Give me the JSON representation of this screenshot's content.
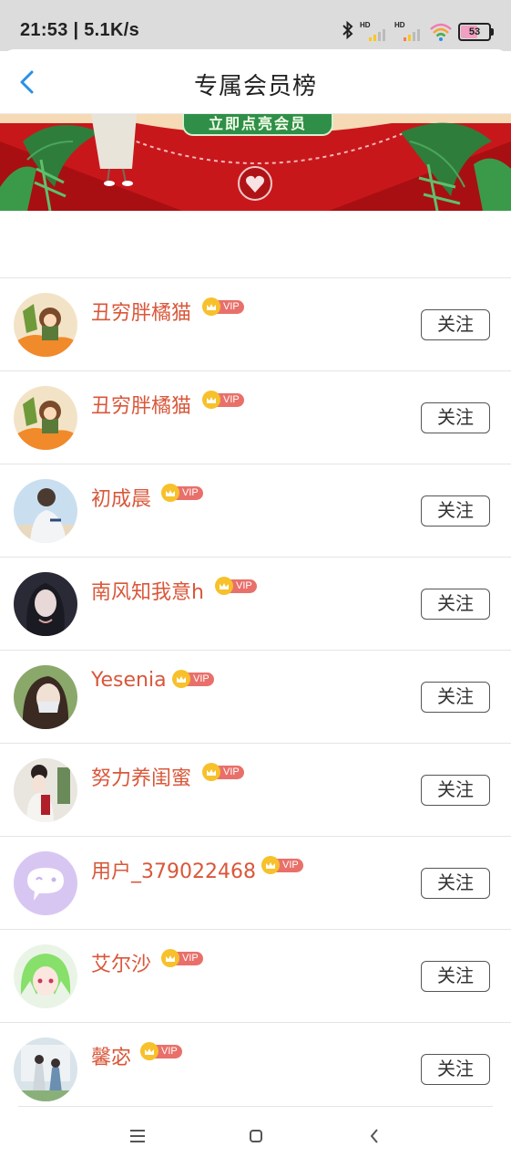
{
  "status_bar": {
    "time": "21:53 | 5.1K/s",
    "battery": "53",
    "hd_label_1": "HD",
    "hd_label_2": "HD"
  },
  "header": {
    "title": "专属会员榜",
    "back_icon": "chevron-left-icon"
  },
  "banner": {
    "cta_label": "立即点亮会员"
  },
  "members": [
    {
      "name": "丑穷胖橘猫",
      "badge": "VIP",
      "follow_label": "关注"
    },
    {
      "name": "丑穷胖橘猫",
      "badge": "VIP",
      "follow_label": "关注"
    },
    {
      "name": "初成晨",
      "badge": "VIP",
      "follow_label": "关注"
    },
    {
      "name": "南风知我意h",
      "badge": "VIP",
      "follow_label": "关注"
    },
    {
      "name": "Yesenia",
      "badge": "VIP",
      "follow_label": "关注"
    },
    {
      "name": "努力养闺蜜",
      "badge": "VIP",
      "follow_label": "关注"
    },
    {
      "name": "用户_379022468",
      "badge": "VIP",
      "follow_label": "关注"
    },
    {
      "name": "艾尔沙",
      "badge": "VIP",
      "follow_label": "关注"
    },
    {
      "name": "馨宓",
      "badge": "VIP",
      "follow_label": "关注"
    }
  ],
  "colors": {
    "name": "#d9573a",
    "vip": "#e9706a",
    "crown": "#f6c12b",
    "accent": "#2a8fe8",
    "banner_red": "#c8171b"
  },
  "system_nav": {
    "menu_icon": "menu-icon",
    "home_icon": "home-icon",
    "back_icon": "back-icon"
  }
}
